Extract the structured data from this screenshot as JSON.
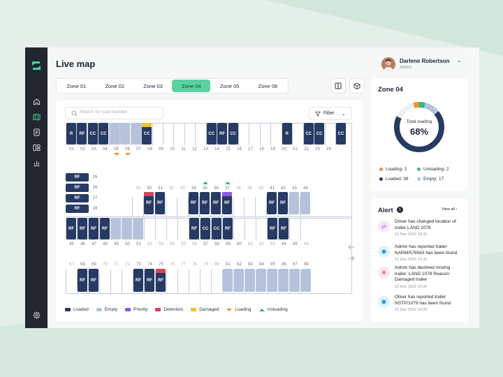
{
  "page": {
    "title": "Live map"
  },
  "user": {
    "name": "Darlene Robertson",
    "role": "Admin"
  },
  "tabs": [
    "Zone 01",
    "Zone 02",
    "Zone 03",
    "Zone 04",
    "Zone 05",
    "Zone 06"
  ],
  "active_tab": "Zone 04",
  "search": {
    "placeholder": "Search for load number"
  },
  "filter": {
    "label": "Filter"
  },
  "map": {
    "row1": {
      "numbers": [
        "01",
        "02",
        "03",
        "04",
        "05",
        "06",
        "07",
        "08",
        "09",
        "10",
        "11",
        "12",
        "13",
        "14",
        "15",
        "16",
        "17",
        "18",
        "19",
        "20",
        "21",
        "22",
        "23",
        "24"
      ],
      "slots": [
        {
          "s": "loaded",
          "l": "R"
        },
        {
          "s": "loaded",
          "l": "RF"
        },
        {
          "s": "loaded",
          "l": "CC"
        },
        {
          "s": "loaded",
          "l": "CC"
        },
        {
          "s": "empty",
          "l": ""
        },
        {
          "s": "empty",
          "l": ""
        },
        {
          "s": "empty",
          "l": ""
        },
        {
          "s": "loaded",
          "l": "CC",
          "stripe": "damaged"
        },
        {
          "s": "none"
        },
        {
          "s": "none"
        },
        {
          "s": "none"
        },
        {
          "s": "none"
        },
        {
          "s": "none"
        },
        {
          "s": "loaded",
          "l": "CC"
        },
        {
          "s": "loaded",
          "l": "RF"
        },
        {
          "s": "loaded",
          "l": "CC"
        },
        {
          "s": "none"
        },
        {
          "s": "none"
        },
        {
          "s": "none"
        },
        {
          "s": "none"
        },
        {
          "s": "loaded",
          "l": "R"
        },
        {
          "s": "none"
        },
        {
          "s": "loaded",
          "l": "CC"
        },
        {
          "s": "loaded",
          "l": "CC"
        },
        {
          "s": "none"
        },
        {
          "s": "loaded",
          "l": "CC"
        }
      ],
      "loading_markers": [
        "05",
        "06"
      ]
    },
    "side": [
      {
        "n": "25",
        "l": "RF"
      },
      {
        "n": "26",
        "l": "RF"
      },
      {
        "n": "27",
        "l": "RF"
      },
      {
        "n": "28",
        "l": "RF"
      }
    ],
    "row2": {
      "numbers": [
        "29",
        "30",
        "31",
        "32",
        "33",
        "34",
        "35",
        "36",
        "37",
        "38",
        "39",
        "40",
        "41",
        "42",
        "43",
        "44"
      ],
      "slots": [
        {
          "s": "none"
        },
        {
          "s": "loaded",
          "l": "RF",
          "stripe": "detention"
        },
        {
          "s": "loaded",
          "l": "RF"
        },
        {
          "s": "none"
        },
        {
          "s": "none"
        },
        {
          "s": "loaded",
          "l": "RF"
        },
        {
          "s": "loaded",
          "l": "RF"
        },
        {
          "s": "loaded",
          "l": "RF"
        },
        {
          "s": "loaded",
          "l": "RF",
          "stripe": "priority"
        },
        {
          "s": "none"
        },
        {
          "s": "none"
        },
        {
          "s": "none"
        },
        {
          "s": "loaded",
          "l": "RF"
        },
        {
          "s": "loaded",
          "l": "RF"
        },
        {
          "s": "empty",
          "l": ""
        },
        {
          "s": "empty",
          "l": ""
        }
      ],
      "unloading_markers": [
        "35",
        "37"
      ]
    },
    "row3": {
      "numbers": [
        "45",
        "46",
        "47",
        "48",
        "49",
        "50",
        "51",
        "52",
        "53",
        "54",
        "55",
        "56",
        "57",
        "58",
        "59",
        "60",
        "61",
        "62",
        "63",
        "64",
        "65",
        "66"
      ],
      "slots": [
        {
          "s": "loaded",
          "l": "RF"
        },
        {
          "s": "loaded",
          "l": "RF"
        },
        {
          "s": "loaded",
          "l": "RF"
        },
        {
          "s": "loaded",
          "l": "RF"
        },
        {
          "s": "empty",
          "l": ""
        },
        {
          "s": "empty",
          "l": ""
        },
        {
          "s": "empty",
          "l": ""
        },
        {
          "s": "none"
        },
        {
          "s": "none"
        },
        {
          "s": "none"
        },
        {
          "s": "none"
        },
        {
          "s": "loaded",
          "l": "RF"
        },
        {
          "s": "loaded",
          "l": "CC"
        },
        {
          "s": "loaded",
          "l": "CC"
        },
        {
          "s": "loaded",
          "l": "RF"
        },
        {
          "s": "none"
        },
        {
          "s": "none"
        },
        {
          "s": "none"
        },
        {
          "s": "loaded",
          "l": "RF"
        },
        {
          "s": "loaded",
          "l": "RF"
        },
        {
          "s": "none"
        },
        {
          "s": "none"
        }
      ]
    },
    "row4": {
      "numbers": [
        "67",
        "68",
        "69",
        "70",
        "71",
        "72",
        "73",
        "74",
        "75",
        "76",
        "77",
        "78",
        "79",
        "80",
        "81",
        "82",
        "83",
        "84",
        "85",
        "86",
        "87",
        "88"
      ],
      "slots": [
        {
          "s": "none"
        },
        {
          "s": "loaded",
          "l": "RF"
        },
        {
          "s": "loaded",
          "l": "RF"
        },
        {
          "s": "none"
        },
        {
          "s": "none"
        },
        {
          "s": "none"
        },
        {
          "s": "loaded",
          "l": "RF"
        },
        {
          "s": "loaded",
          "l": "RF"
        },
        {
          "s": "loaded",
          "l": "RF",
          "stripe": "detention"
        },
        {
          "s": "none"
        },
        {
          "s": "none"
        },
        {
          "s": "none"
        },
        {
          "s": "none"
        },
        {
          "s": "none"
        },
        {
          "s": "empty",
          "l": ""
        },
        {
          "s": "empty",
          "l": ""
        },
        {
          "s": "empty",
          "l": ""
        },
        {
          "s": "empty",
          "l": ""
        },
        {
          "s": "empty",
          "l": ""
        },
        {
          "s": "empty",
          "l": ""
        },
        {
          "s": "empty",
          "l": ""
        },
        {
          "s": "empty",
          "l": ""
        }
      ]
    }
  },
  "legend": [
    {
      "label": "Loaded",
      "kind": "sw",
      "color": "#263a63"
    },
    {
      "label": "Empty",
      "kind": "sw",
      "color": "#b4c3db"
    },
    {
      "label": "Priority",
      "kind": "sw",
      "color": "#8a5ce6"
    },
    {
      "label": "Detention",
      "kind": "sw",
      "color": "#d9435a"
    },
    {
      "label": "Damaged",
      "kind": "sw",
      "color": "#f2c230"
    },
    {
      "label": "Loading",
      "kind": "down",
      "color": "#f0922e"
    },
    {
      "label": "Unloading",
      "kind": "up",
      "color": "#2eb882"
    }
  ],
  "zone": {
    "title": "Zone 04",
    "total_label": "Total loading",
    "total_value": "68%",
    "total_fraction": 0.68,
    "stats": [
      {
        "label": "Loading: 2",
        "color": "#f0922e"
      },
      {
        "label": "Unloading: 2",
        "color": "#2eb882"
      },
      {
        "label": "Loaded: 39",
        "color": "#263a63"
      },
      {
        "label": "Empty: 17",
        "color": "#b4c3db"
      }
    ]
  },
  "alerts": {
    "title": "Alert",
    "count": "5",
    "view_all": "View all",
    "items": [
      {
        "text": "Driver has changed location of trailer LAND 1078",
        "date": "12 Dec 2022  10:32",
        "icon": "location-change-icon",
        "color": "#a855f7",
        "bg": "#f3e8ff"
      },
      {
        "text": "Admin has reported trailer NARM/576543 has been found",
        "date": "12 Dec 2022  10:32",
        "icon": "cube-icon",
        "color": "#2aa3e0",
        "bg": "#e0f2fb"
      },
      {
        "text": "Admin has declined moving trailer: LAND 1078 Reason: Damaged trailer",
        "date": "12 Dec 2022  10:32",
        "icon": "decline-icon",
        "color": "#e0445b",
        "bg": "#fde6ea"
      },
      {
        "text": "Oliver has reported trailer NSTP/1079 has been found",
        "date": "12 Dec 2022  10:20",
        "icon": "cube-icon",
        "color": "#2aa3e0",
        "bg": "#e0f2fb"
      }
    ]
  }
}
